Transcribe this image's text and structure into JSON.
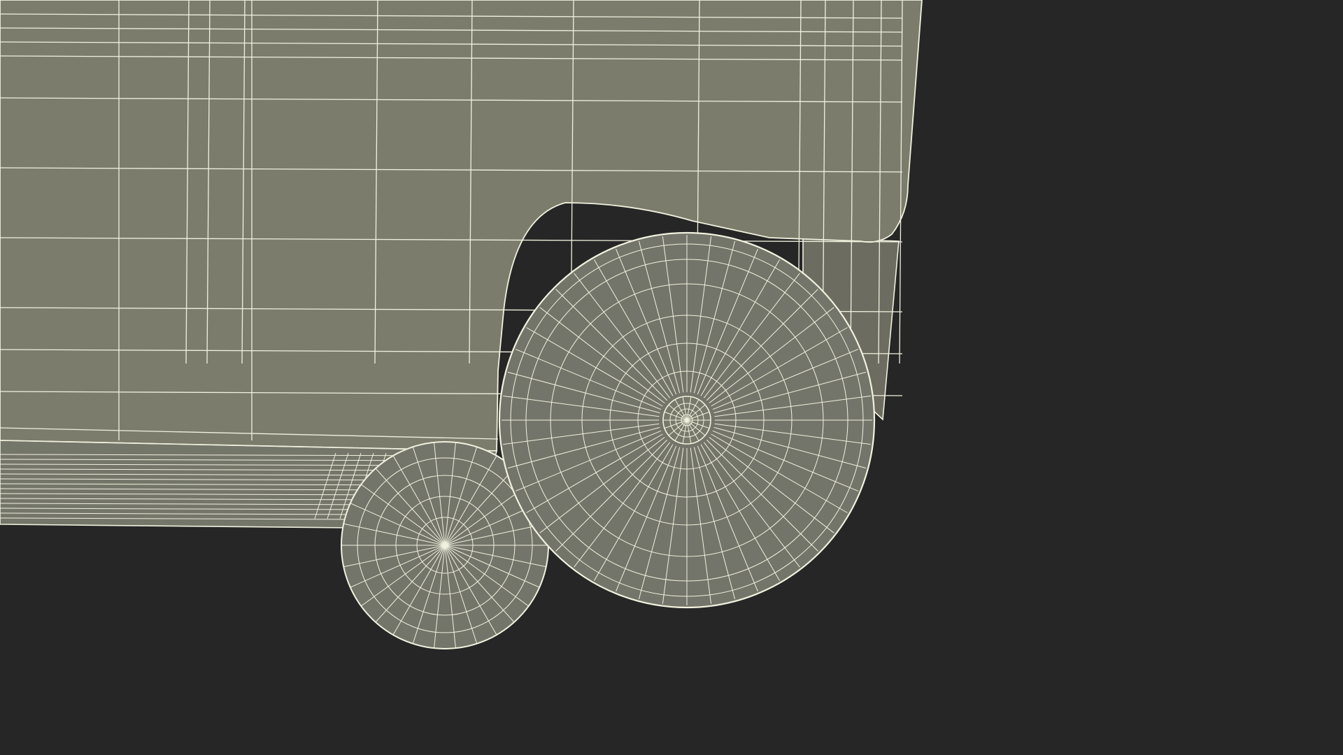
{
  "scene": {
    "subject": "wireframe-wheeled-bin",
    "colors": {
      "background": "#262626",
      "body_fill": "#7c7c6c",
      "body_shadow": "#6a6b5e",
      "underside_fill": "#75766a",
      "wire": "#f1f1df",
      "wheel_fill": "#74756a"
    }
  }
}
